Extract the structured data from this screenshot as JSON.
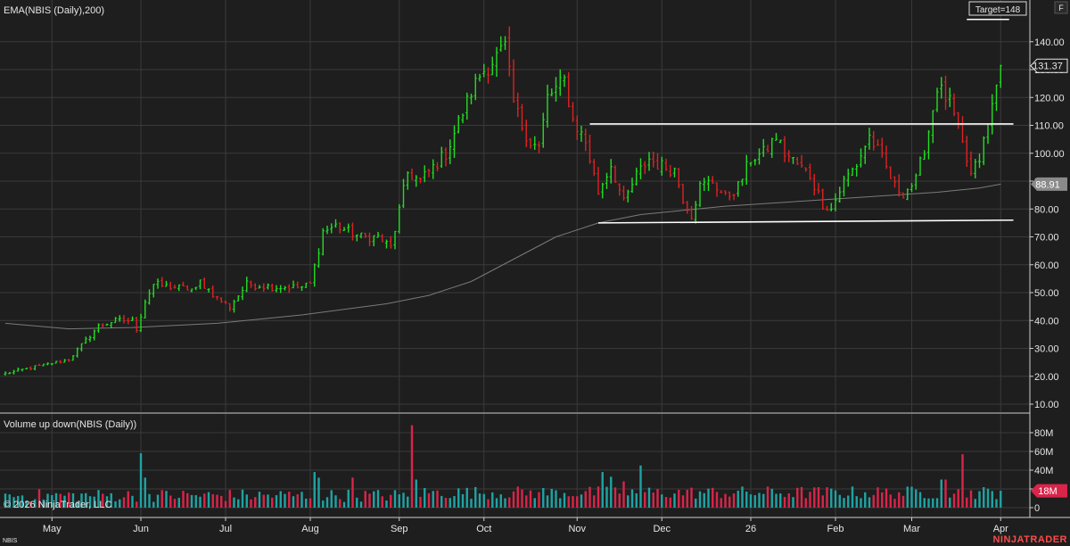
{
  "price_panel_title": "EMA(NBIS (Daily),200)",
  "volume_panel_title": "Volume up down(NBIS (Daily))",
  "copyright": "© 2026 NinjaTrader, LLC",
  "symbol": "NBIS",
  "brand": "NINJATRADER",
  "f_button": "F",
  "target_label": "Target=148",
  "last_price_label": "131.37",
  "ema_value_label": "88.91",
  "last_volume_label": "18M",
  "colors": {
    "background": "#1e1e1e",
    "up": "#22dd22",
    "down": "#dd2222",
    "volume_up": "#1fa3a3",
    "volume_down": "#d9254a",
    "ema": "#7a7a7a",
    "channel": "#ffffff",
    "grid": "#3a3a3a",
    "brand": "#ff4a4a"
  },
  "chart_data": [
    {
      "type": "candlestick",
      "title": "EMA(NBIS (Daily),200)",
      "ylim": [
        5,
        150
      ],
      "yticks": [
        10,
        20,
        30,
        40,
        50,
        60,
        70,
        80,
        90,
        100,
        110,
        120,
        130,
        140
      ],
      "ytick_labels": [
        "10.00",
        "20.00",
        "30.00",
        "40.00",
        "50.00",
        "60.00",
        "70.00",
        "80.00",
        "90.00",
        "100.00",
        "110.00",
        "120.00",
        "130.00",
        "140.00"
      ],
      "xtick_labels": [
        "May",
        "Jun",
        "Jul",
        "Aug",
        "Sep",
        "Oct",
        "Nov",
        "Dec",
        "26",
        "Feb",
        "Mar",
        "Apr"
      ],
      "xtick_sessions": [
        11,
        32,
        52,
        72,
        93,
        113,
        135,
        155,
        176,
        196,
        214,
        235
      ],
      "grid": true,
      "anchors": [
        [
          0,
          21
        ],
        [
          9,
          24
        ],
        [
          15,
          26
        ],
        [
          22,
          38
        ],
        [
          26,
          40
        ],
        [
          30,
          40
        ],
        [
          31,
          37
        ],
        [
          33,
          47
        ],
        [
          35,
          53
        ],
        [
          45,
          51
        ],
        [
          46,
          54
        ],
        [
          50,
          48
        ],
        [
          53,
          45
        ],
        [
          57,
          53
        ],
        [
          64,
          52
        ],
        [
          70,
          52
        ],
        [
          72,
          53
        ],
        [
          75,
          72
        ],
        [
          78,
          74
        ],
        [
          84,
          70
        ],
        [
          88,
          70
        ],
        [
          91,
          66
        ],
        [
          95,
          93
        ],
        [
          98,
          90
        ],
        [
          104,
          100
        ],
        [
          110,
          122
        ],
        [
          112,
          128
        ],
        [
          115,
          133
        ],
        [
          118,
          138
        ],
        [
          120,
          118
        ],
        [
          122,
          110
        ],
        [
          124,
          104
        ],
        [
          126,
          102
        ],
        [
          128,
          120
        ],
        [
          132,
          126
        ],
        [
          134,
          112
        ],
        [
          137,
          104
        ],
        [
          140,
          86
        ],
        [
          143,
          96
        ],
        [
          146,
          82
        ],
        [
          149,
          92
        ],
        [
          152,
          98
        ],
        [
          154,
          96
        ],
        [
          158,
          94
        ],
        [
          160,
          84
        ],
        [
          162,
          78
        ],
        [
          164,
          88
        ],
        [
          167,
          90
        ],
        [
          170,
          84
        ],
        [
          173,
          88
        ],
        [
          176,
          98
        ],
        [
          179,
          100
        ],
        [
          182,
          106
        ],
        [
          184,
          100
        ],
        [
          187,
          96
        ],
        [
          190,
          92
        ],
        [
          193,
          82
        ],
        [
          195,
          80
        ],
        [
          198,
          90
        ],
        [
          201,
          96
        ],
        [
          204,
          106
        ],
        [
          207,
          98
        ],
        [
          210,
          88
        ],
        [
          212,
          86
        ],
        [
          215,
          90
        ],
        [
          218,
          108
        ],
        [
          220,
          124
        ],
        [
          223,
          118
        ],
        [
          225,
          108
        ],
        [
          228,
          92
        ],
        [
          230,
          98
        ],
        [
          232,
          110
        ],
        [
          234,
          124
        ],
        [
          235,
          131.37
        ]
      ],
      "channel_lines": [
        {
          "sessions": [
            138,
            238
          ],
          "values": [
            110.5,
            110.5
          ]
        },
        {
          "sessions": [
            140,
            238
          ],
          "values": [
            75.0,
            76.0
          ]
        },
        {
          "sessions": [
            227,
            237
          ],
          "values": [
            148,
            148
          ]
        }
      ],
      "ema_200": [
        [
          0,
          39
        ],
        [
          15,
          37
        ],
        [
          30,
          37.5
        ],
        [
          50,
          39
        ],
        [
          70,
          42
        ],
        [
          90,
          46
        ],
        [
          100,
          49
        ],
        [
          110,
          54
        ],
        [
          120,
          62
        ],
        [
          130,
          70
        ],
        [
          140,
          75
        ],
        [
          150,
          78
        ],
        [
          160,
          79.5
        ],
        [
          170,
          81
        ],
        [
          180,
          82
        ],
        [
          190,
          83
        ],
        [
          200,
          84
        ],
        [
          210,
          85
        ],
        [
          220,
          86
        ],
        [
          230,
          87.5
        ],
        [
          235,
          88.91
        ]
      ],
      "last_price": 131.37,
      "ema_last": 88.91,
      "target": 148
    },
    {
      "type": "bar",
      "title": "Volume up down(NBIS (Daily))",
      "ylim": [
        0,
        92
      ],
      "yticks": [
        0,
        20,
        40,
        60,
        80
      ],
      "ytick_labels": [
        "0",
        "20M",
        "40M",
        "60M",
        "80M"
      ],
      "grid": true,
      "spikes": [
        [
          96,
          88
        ],
        [
          97,
          30
        ],
        [
          32,
          58
        ],
        [
          33,
          32
        ],
        [
          73,
          38
        ],
        [
          74,
          32
        ],
        [
          82,
          32
        ],
        [
          141,
          38
        ],
        [
          143,
          33
        ],
        [
          146,
          28
        ],
        [
          150,
          45
        ],
        [
          226,
          57
        ],
        [
          221,
          30
        ],
        [
          222,
          30
        ]
      ],
      "last_volume": 18
    }
  ]
}
